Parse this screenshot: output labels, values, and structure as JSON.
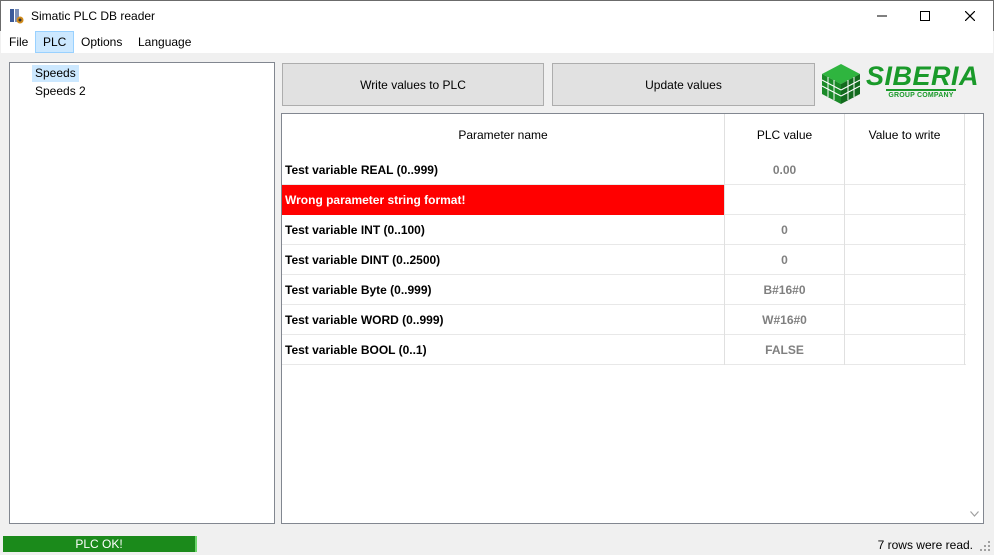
{
  "window": {
    "title": "Simatic PLC DB reader"
  },
  "menu": [
    "File",
    "PLC",
    "Options",
    "Language"
  ],
  "tree": [
    "Speeds",
    "Speeds 2"
  ],
  "buttons": {
    "write": "Write values to PLC",
    "update": "Update values"
  },
  "logo": {
    "name": "SIBERIA",
    "tagline": "GROUP COMPANY"
  },
  "grid": {
    "headers": [
      "Parameter name",
      "PLC value",
      "Value to write"
    ],
    "rows": [
      {
        "name": "Test variable REAL (0..999)",
        "value": "0.00",
        "write": ""
      },
      {
        "name": "Wrong parameter string format!",
        "value": "",
        "write": "",
        "error": true
      },
      {
        "name": "Test variable INT (0..100)",
        "value": "0",
        "write": ""
      },
      {
        "name": "Test variable DINT (0..2500)",
        "value": "0",
        "write": ""
      },
      {
        "name": "Test variable Byte (0..999)",
        "value": "B#16#0",
        "write": ""
      },
      {
        "name": "Test variable WORD (0..999)",
        "value": "W#16#0",
        "write": ""
      },
      {
        "name": "Test variable BOOL (0..1)",
        "value": "FALSE",
        "write": ""
      }
    ]
  },
  "status": {
    "plc": "PLC OK!",
    "rows": "7 rows were read."
  },
  "colors": {
    "error": "#ff0000",
    "ok": "#1b8a1b",
    "brand": "#1a9a2a",
    "selection": "#cce8ff"
  }
}
